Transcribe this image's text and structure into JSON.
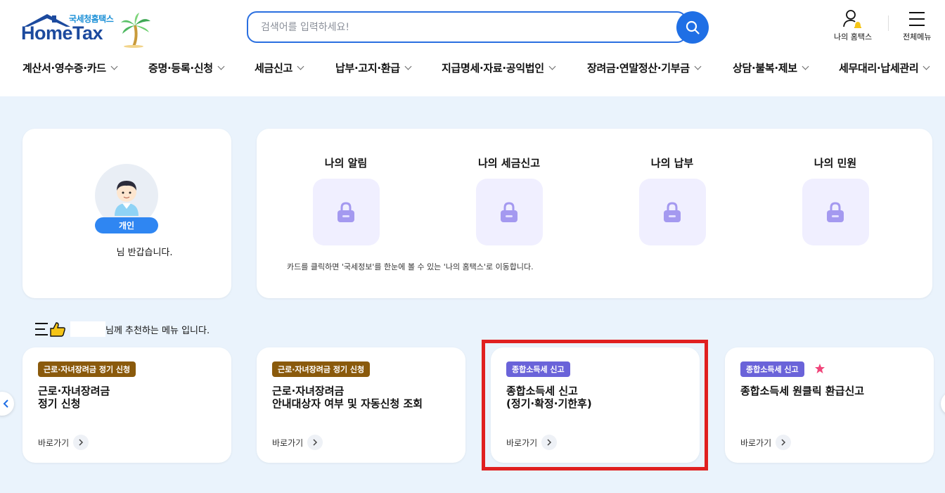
{
  "header": {
    "logo_sub": "국세청홈택스",
    "logo_main": "HomeTax",
    "search_placeholder": "검색어를 입력하세요!",
    "my_hometax_label": "나의 홈택스",
    "all_menu_label": "전체메뉴"
  },
  "nav": {
    "items": [
      {
        "label": "계산서·영수증·카드"
      },
      {
        "label": "증명·등록·신청"
      },
      {
        "label": "세금신고"
      },
      {
        "label": "납부·고지·환급"
      },
      {
        "label": "지급명세·자료·공익법인"
      },
      {
        "label": "장려금·연말정산·기부금"
      },
      {
        "label": "상담·불복·제보"
      },
      {
        "label": "세무대리·납세관리"
      }
    ]
  },
  "profile": {
    "badge": "개인",
    "greeting": "님 반갑습니다."
  },
  "quick": {
    "items": [
      {
        "label": "나의 알림"
      },
      {
        "label": "나의 세금신고"
      },
      {
        "label": "나의 납부"
      },
      {
        "label": "나의 민원"
      }
    ],
    "note": "카드를 클릭하면 '국세정보'를 한눈에 볼 수 있는 '나의 홈택스'로 이동합니다."
  },
  "recommend": {
    "header_text": "님께 추천하는 메뉴 입니다.",
    "goto_label": "바로가기",
    "cards": [
      {
        "tag": "근로·자녀장려금 정기 신청",
        "title": "근로·자녀장려금\n정기 신청"
      },
      {
        "tag": "근로·자녀장려금 정기 신청",
        "title": "근로·자녀장려금\n안내대상자 여부 및 자동신청 조회"
      },
      {
        "tag": "종합소득세 신고",
        "title": "종합소득세 신고\n(정기·확정·기한후)"
      },
      {
        "tag": "종합소득세 신고",
        "title": "종합소득세 원클릭 환급신고"
      }
    ]
  },
  "colors": {
    "brand_blue": "#1f6fe5",
    "tag_brown": "#8a5a0c",
    "tag_purple": "#6a63d9",
    "highlight_red": "#e02020",
    "background": "#eaf3fc"
  }
}
